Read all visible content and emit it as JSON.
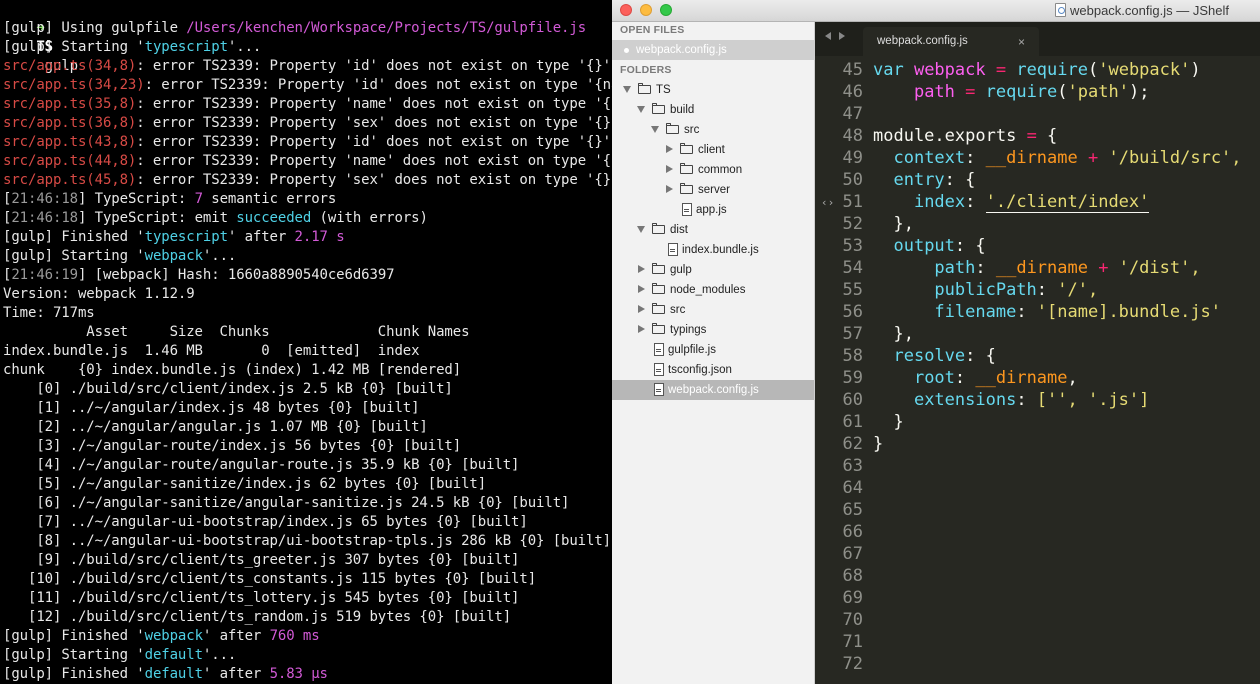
{
  "terminal": {
    "prompt": {
      "arrow": "➜",
      "dir": "TS",
      "cmd": "gulp"
    },
    "lines": [
      [
        [
          "[gulp] ",
          "white"
        ],
        [
          "Using gulpfile ",
          "white"
        ],
        [
          "/Users/kenchen/Workspace/Projects/TS/gulpfile.js",
          "mag"
        ]
      ],
      [
        [
          "[gulp] ",
          "white"
        ],
        [
          "Starting '",
          "white"
        ],
        [
          "typescript",
          "cyan"
        ],
        [
          "'...",
          "white"
        ]
      ],
      [
        [
          "src/app.ts(34,8)",
          "red"
        ],
        [
          ": error TS2339: Property 'id' does not exist on type '{}'.",
          "white"
        ]
      ],
      [
        [
          "src/app.ts(34,23)",
          "red"
        ],
        [
          ": error TS2339: Property 'id' does not exist on type '{name",
          "white"
        ]
      ],
      [
        [
          "src/app.ts(35,8)",
          "red"
        ],
        [
          ": error TS2339: Property 'name' does not exist on type '{}'.",
          "white"
        ]
      ],
      [
        [
          "src/app.ts(36,8)",
          "red"
        ],
        [
          ": error TS2339: Property 'sex' does not exist on type '{}'.",
          "white"
        ]
      ],
      [
        [
          "src/app.ts(43,8)",
          "red"
        ],
        [
          ": error TS2339: Property 'id' does not exist on type '{}'.",
          "white"
        ]
      ],
      [
        [
          "src/app.ts(44,8)",
          "red"
        ],
        [
          ": error TS2339: Property 'name' does not exist on type '{}'.",
          "white"
        ]
      ],
      [
        [
          "src/app.ts(45,8)",
          "red"
        ],
        [
          ": error TS2339: Property 'sex' does not exist on type '{}'.",
          "white"
        ]
      ],
      [
        [
          "[",
          "white"
        ],
        [
          "21:46:18",
          "gray"
        ],
        [
          "] TypeScript: ",
          "white"
        ],
        [
          "7",
          "mag"
        ],
        [
          " semantic errors",
          "white"
        ]
      ],
      [
        [
          "[",
          "white"
        ],
        [
          "21:46:18",
          "gray"
        ],
        [
          "] TypeScript: emit ",
          "white"
        ],
        [
          "succeeded",
          "cyan"
        ],
        [
          " (with errors)",
          "white"
        ]
      ],
      [
        [
          "[gulp] ",
          "white"
        ],
        [
          "Finished '",
          "white"
        ],
        [
          "typescript",
          "cyan"
        ],
        [
          "' after ",
          "white"
        ],
        [
          "2.17 s",
          "mag"
        ]
      ],
      [
        [
          "[gulp] ",
          "white"
        ],
        [
          "Starting '",
          "white"
        ],
        [
          "webpack",
          "cyan"
        ],
        [
          "'...",
          "white"
        ]
      ],
      [
        [
          "[",
          "white"
        ],
        [
          "21:46:19",
          "gray"
        ],
        [
          "] [webpack] Hash: 1660a8890540ce6d6397",
          "white"
        ]
      ],
      [
        [
          "Version: webpack 1.12.9",
          "white"
        ]
      ],
      [
        [
          "Time: 717ms",
          "white"
        ]
      ],
      [
        [
          "          Asset     Size  Chunks             Chunk Names",
          "white"
        ]
      ],
      [
        [
          "index.bundle.js  1.46 MB       0  [emitted]  index",
          "white"
        ]
      ],
      [
        [
          "chunk    {0} index.bundle.js (index) 1.42 MB [rendered]",
          "white"
        ]
      ],
      [
        [
          "    [0] ./build/src/client/index.js 2.5 kB {0} [built]",
          "white"
        ]
      ],
      [
        [
          "    [1] ../~/angular/index.js 48 bytes {0} [built]",
          "white"
        ]
      ],
      [
        [
          "    [2] ../~/angular/angular.js 1.07 MB {0} [built]",
          "white"
        ]
      ],
      [
        [
          "    [3] ./~/angular-route/index.js 56 bytes {0} [built]",
          "white"
        ]
      ],
      [
        [
          "    [4] ./~/angular-route/angular-route.js 35.9 kB {0} [built]",
          "white"
        ]
      ],
      [
        [
          "    [5] ./~/angular-sanitize/index.js 62 bytes {0} [built]",
          "white"
        ]
      ],
      [
        [
          "    [6] ./~/angular-sanitize/angular-sanitize.js 24.5 kB {0} [built]",
          "white"
        ]
      ],
      [
        [
          "    [7] ../~/angular-ui-bootstrap/index.js 65 bytes {0} [built]",
          "white"
        ]
      ],
      [
        [
          "    [8] ../~/angular-ui-bootstrap/ui-bootstrap-tpls.js 286 kB {0} [built]",
          "white"
        ]
      ],
      [
        [
          "    [9] ./build/src/client/ts_greeter.js 307 bytes {0} [built]",
          "white"
        ]
      ],
      [
        [
          "   [10] ./build/src/client/ts_constants.js 115 bytes {0} [built]",
          "white"
        ]
      ],
      [
        [
          "   [11] ./build/src/client/ts_lottery.js 545 bytes {0} [built]",
          "white"
        ]
      ],
      [
        [
          "   [12] ./build/src/client/ts_random.js 519 bytes {0} [built]",
          "white"
        ]
      ],
      [
        [
          "[gulp] ",
          "white"
        ],
        [
          "Finished '",
          "white"
        ],
        [
          "webpack",
          "cyan"
        ],
        [
          "' after ",
          "white"
        ],
        [
          "760 ms",
          "mag"
        ]
      ],
      [
        [
          "[gulp] ",
          "white"
        ],
        [
          "Starting '",
          "white"
        ],
        [
          "default",
          "cyan"
        ],
        [
          "'...",
          "white"
        ]
      ],
      [
        [
          "[gulp] ",
          "white"
        ],
        [
          "Finished '",
          "white"
        ],
        [
          "default",
          "cyan"
        ],
        [
          "' after ",
          "white"
        ],
        [
          "5.83 μs",
          "mag"
        ]
      ]
    ]
  },
  "window": {
    "title": "webpack.config.js — JShelf"
  },
  "sidebar": {
    "open_files_header": "OPEN FILES",
    "open_file": "webpack.config.js",
    "folders_header": "FOLDERS",
    "tree": [
      {
        "label": "TS",
        "kind": "folder",
        "depth": 0,
        "expanded": true
      },
      {
        "label": "build",
        "kind": "folder",
        "depth": 1,
        "expanded": true
      },
      {
        "label": "src",
        "kind": "folder",
        "depth": 2,
        "expanded": true
      },
      {
        "label": "client",
        "kind": "folder",
        "depth": 3,
        "expanded": false
      },
      {
        "label": "common",
        "kind": "folder",
        "depth": 3,
        "expanded": false
      },
      {
        "label": "server",
        "kind": "folder",
        "depth": 3,
        "expanded": false
      },
      {
        "label": "app.js",
        "kind": "file",
        "depth": 3
      },
      {
        "label": "dist",
        "kind": "folder",
        "depth": 1,
        "expanded": true
      },
      {
        "label": "index.bundle.js",
        "kind": "file",
        "depth": 2
      },
      {
        "label": "gulp",
        "kind": "folder",
        "depth": 1,
        "expanded": false
      },
      {
        "label": "node_modules",
        "kind": "folder",
        "depth": 1,
        "expanded": false
      },
      {
        "label": "src",
        "kind": "folder",
        "depth": 1,
        "expanded": false
      },
      {
        "label": "typings",
        "kind": "folder",
        "depth": 1,
        "expanded": false
      },
      {
        "label": "gulpfile.js",
        "kind": "file",
        "depth": 1
      },
      {
        "label": "tsconfig.json",
        "kind": "file",
        "depth": 1
      },
      {
        "label": "webpack.config.js",
        "kind": "file",
        "depth": 1,
        "selected": true
      }
    ]
  },
  "tab": {
    "label": "webpack.config.js",
    "close": "×"
  },
  "editor": {
    "lines": [
      {
        "n": "45",
        "code": [
          [
            "var ",
            "k"
          ],
          [
            "webpack",
            "v"
          ],
          [
            " = ",
            "o"
          ],
          [
            "require",
            "fn"
          ],
          [
            "(",
            "p"
          ],
          [
            "'webpack'",
            "s"
          ],
          [
            ")",
            "p"
          ]
        ]
      },
      {
        "n": "46",
        "code": [
          [
            "    ",
            "g2"
          ],
          [
            "path",
            "v"
          ],
          [
            " = ",
            "o"
          ],
          [
            "require",
            "fn"
          ],
          [
            "(",
            "p"
          ],
          [
            "'path'",
            "s"
          ],
          [
            ");",
            "p"
          ]
        ]
      },
      {
        "n": "47",
        "code": []
      },
      {
        "n": "48",
        "code": [
          [
            "module",
            "p"
          ],
          [
            ".",
            "p"
          ],
          [
            "exports",
            "p"
          ],
          [
            " = ",
            "o"
          ],
          [
            "{",
            "p"
          ]
        ]
      },
      {
        "n": "49",
        "code": [
          [
            "  ",
            "g1"
          ],
          [
            "context",
            "fn"
          ],
          [
            ": ",
            "p"
          ],
          [
            "__dirname",
            "d"
          ],
          [
            " + ",
            "o"
          ],
          [
            "'/build/src',",
            "s"
          ]
        ]
      },
      {
        "n": "50",
        "code": [
          [
            "  ",
            "g1"
          ],
          [
            "entry",
            "fn"
          ],
          [
            ": ",
            "p"
          ],
          [
            "{",
            "p"
          ]
        ]
      },
      {
        "n": "51",
        "code": [
          [
            "    ",
            "g2"
          ],
          [
            "index",
            "fn"
          ],
          [
            ": ",
            "p"
          ],
          [
            "'./client/index'",
            "s"
          ]
        ]
      },
      {
        "n": "52",
        "code": [
          [
            "  ",
            "g1"
          ],
          [
            "},",
            "p"
          ]
        ]
      },
      {
        "n": "53",
        "code": [
          [
            "  ",
            "g1"
          ],
          [
            "output",
            "fn"
          ],
          [
            ": ",
            "p"
          ],
          [
            "{",
            "p"
          ]
        ]
      },
      {
        "n": "54",
        "code": [
          [
            "      ",
            "g3"
          ],
          [
            "path",
            "fn"
          ],
          [
            ": ",
            "p"
          ],
          [
            "__dirname",
            "d"
          ],
          [
            " + ",
            "o"
          ],
          [
            "'/dist',",
            "s"
          ]
        ]
      },
      {
        "n": "55",
        "code": [
          [
            "      ",
            "g3"
          ],
          [
            "publicPath",
            "fn"
          ],
          [
            ": ",
            "p"
          ],
          [
            "'/',",
            "s"
          ]
        ]
      },
      {
        "n": "56",
        "code": [
          [
            "      ",
            "g3"
          ],
          [
            "filename",
            "fn"
          ],
          [
            ": ",
            "p"
          ],
          [
            "'[name].bundle.js'",
            "s"
          ]
        ]
      },
      {
        "n": "57",
        "code": [
          [
            "  ",
            "g1"
          ],
          [
            "},",
            "p"
          ]
        ]
      },
      {
        "n": "58",
        "code": [
          [
            "  ",
            "g1"
          ],
          [
            "resolve",
            "fn"
          ],
          [
            ": ",
            "p"
          ],
          [
            "{",
            "p"
          ]
        ]
      },
      {
        "n": "59",
        "code": [
          [
            "    ",
            "g2"
          ],
          [
            "root",
            "fn"
          ],
          [
            ": ",
            "p"
          ],
          [
            "__dirname",
            "d"
          ],
          [
            ",",
            "p"
          ]
        ]
      },
      {
        "n": "60",
        "code": [
          [
            "    ",
            "g2"
          ],
          [
            "extensions",
            "fn"
          ],
          [
            ": ",
            "p"
          ],
          [
            "['', '.js']",
            "s"
          ]
        ]
      },
      {
        "n": "61",
        "code": [
          [
            "  ",
            "g1"
          ],
          [
            "}",
            "p"
          ]
        ]
      },
      {
        "n": "62",
        "code": [
          [
            "}",
            "p"
          ]
        ]
      },
      {
        "n": "63",
        "code": []
      },
      {
        "n": "64",
        "code": []
      },
      {
        "n": "65",
        "code": []
      },
      {
        "n": "66",
        "code": []
      },
      {
        "n": "67",
        "code": []
      },
      {
        "n": "68",
        "code": []
      },
      {
        "n": "69",
        "code": []
      },
      {
        "n": "70",
        "code": []
      },
      {
        "n": "71",
        "code": []
      },
      {
        "n": "72",
        "code": []
      }
    ]
  },
  "colors": {
    "terminal_bg": "#000000",
    "editor_bg": "#272822",
    "string": "#e6db74",
    "keyword": "#66d9ef",
    "operator": "#f92672",
    "error": "#d74a45",
    "highlight": "#d25ad6"
  }
}
